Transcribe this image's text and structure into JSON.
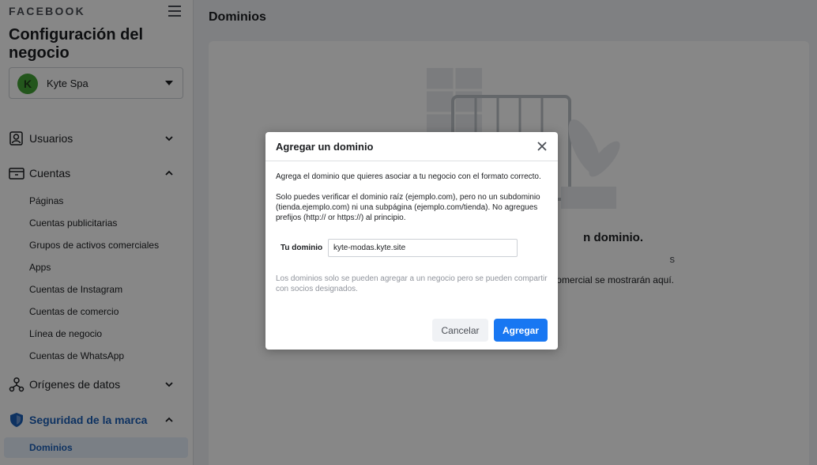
{
  "sidebar": {
    "brand": "FACEBOOK",
    "title": "Configuración del negocio",
    "business": {
      "avatar_letter": "K",
      "name": "Kyte Spa"
    },
    "sections": {
      "users": {
        "label": "Usuarios",
        "icon": "users-icon"
      },
      "accounts": {
        "label": "Cuentas",
        "icon": "accounts-icon",
        "items": [
          "Páginas",
          "Cuentas publicitarias",
          "Grupos de activos comerciales",
          "Apps",
          "Cuentas de Instagram",
          "Cuentas de comercio",
          "Línea de negocio",
          "Cuentas de WhatsApp"
        ]
      },
      "data_sources": {
        "label": "Orígenes de datos",
        "icon": "data-sources-icon"
      },
      "brand_safety": {
        "label": "Seguridad de la marca",
        "icon": "shield-icon",
        "selected_item": "Dominios"
      }
    }
  },
  "main": {
    "title": "Dominios",
    "empty_title": "n dominio.",
    "empty_desc": "s",
    "empty_desc2": "comercial se mostrarán aquí."
  },
  "modal": {
    "title": "Agregar un dominio",
    "p1": "Agrega el dominio que quieres asociar a tu negocio con el formato correcto.",
    "p2": "Solo puedes verificar el dominio raíz (ejemplo.com), pero no un subdominio (tienda.ejemplo.com) ni una subpágina (ejemplo.com/tienda). No agregues prefijos (http:// or https://) al principio.",
    "field_label": "Tu dominio",
    "field_value": "kyte-modas.kyte.site",
    "note": "Los dominios solo se pueden agregar a un negocio pero se pueden compartir con socios designados.",
    "cancel_label": "Cancelar",
    "add_label": "Agregar"
  },
  "colors": {
    "accent": "#1877f2",
    "selected_text": "#1b5fb8",
    "selected_bg": "#e7f0fc",
    "avatar": "#42a335"
  }
}
